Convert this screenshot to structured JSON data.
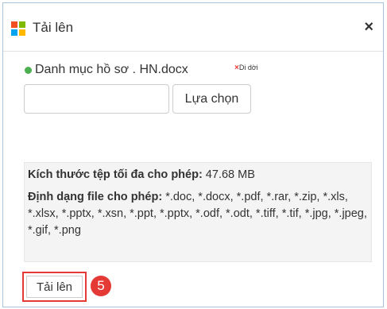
{
  "dialog": {
    "title": "Tải lên",
    "close_glyph": "×",
    "icon": "windows-grid-icon"
  },
  "file": {
    "name": "Danh mục hồ sơ . HN.docx",
    "remove_label": "Di dời",
    "remove_glyph": "×",
    "status_color": "#4caf50"
  },
  "picker": {
    "input_value": "",
    "choose_label": "Lựa chọn"
  },
  "info": {
    "max_size_label": "Kích thước tệp tối đa cho phép:",
    "max_size_value": " 47.68 MB",
    "formats_label": "Định dạng file cho phép:",
    "formats_value": " *.doc, *.docx, *.pdf, *.rar, *.zip, *.xls, *.xlsx, *.pptx, *.xsn, *.ppt, *.pptx, *.odf, *.odt, *.tiff, *.tif, *.jpg, *.jpeg, *.gif, *.png"
  },
  "footer": {
    "upload_label": "Tải lên",
    "step_number": "5"
  },
  "colors": {
    "highlight": "#e53935",
    "border": "#a9c4de"
  }
}
